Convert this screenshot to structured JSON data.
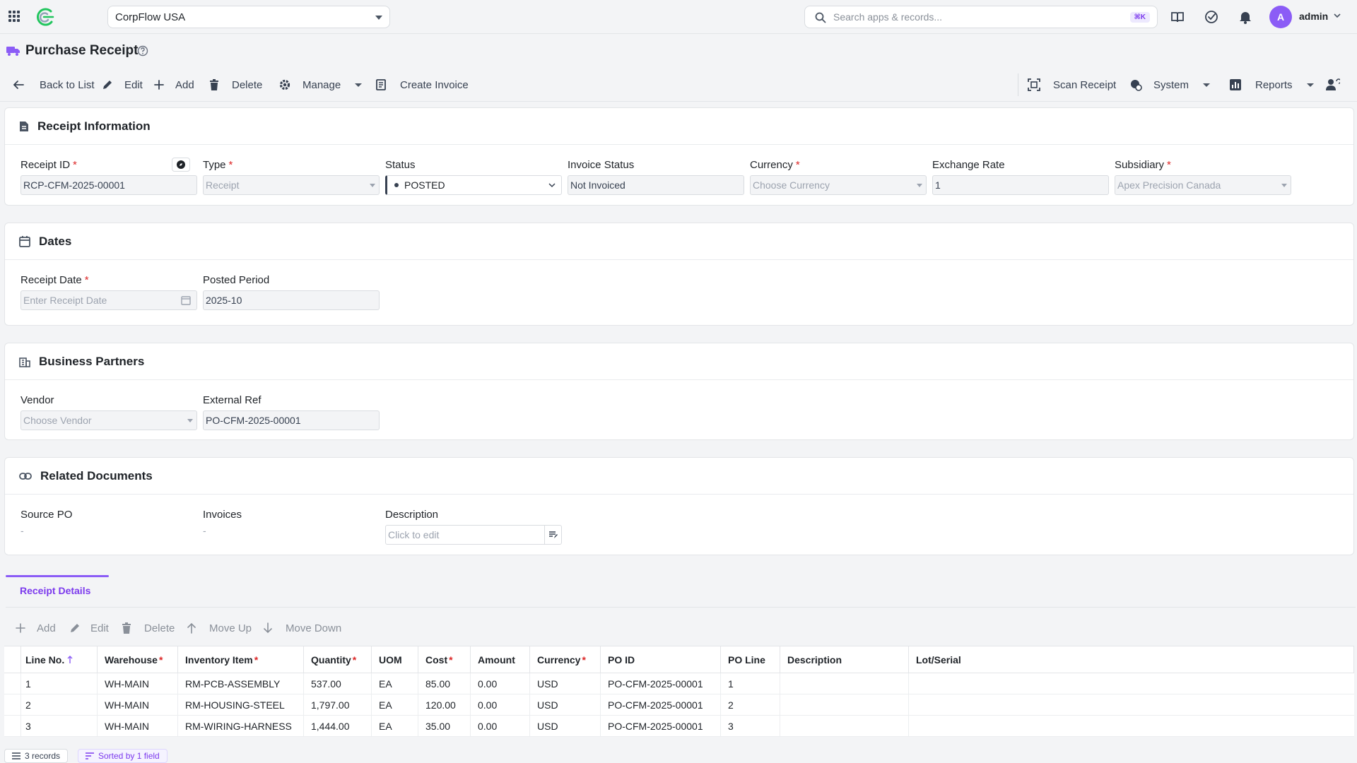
{
  "topbar": {
    "company": "CorpFlow USA",
    "search_placeholder": "Search apps & records...",
    "search_shortcut": "⌘K",
    "user_initial": "A",
    "user_name": "admin"
  },
  "page": {
    "title": "Purchase Receipt"
  },
  "toolbar": {
    "back": "Back to List",
    "edit": "Edit",
    "add": "Add",
    "delete": "Delete",
    "manage": "Manage",
    "create_invoice": "Create Invoice",
    "scan_receipt": "Scan Receipt",
    "system": "System",
    "reports": "Reports"
  },
  "receipt_info": {
    "title": "Receipt Information",
    "receipt_id_label": "Receipt ID",
    "receipt_id_value": "RCP-CFM-2025-00001",
    "type_label": "Type",
    "type_value": "Receipt",
    "status_label": "Status",
    "status_value": "POSTED",
    "invoice_status_label": "Invoice Status",
    "invoice_status_value": "Not Invoiced",
    "currency_label": "Currency",
    "currency_placeholder": "Choose Currency",
    "exchange_rate_label": "Exchange Rate",
    "exchange_rate_value": "1",
    "subsidiary_label": "Subsidiary",
    "subsidiary_value": "Apex Precision Canada"
  },
  "dates": {
    "title": "Dates",
    "receipt_date_label": "Receipt Date",
    "receipt_date_placeholder": "Enter Receipt Date",
    "posted_period_label": "Posted Period",
    "posted_period_value": "2025-10"
  },
  "partners": {
    "title": "Business Partners",
    "vendor_label": "Vendor",
    "vendor_placeholder": "Choose Vendor",
    "external_ref_label": "External Ref",
    "external_ref_value": "PO-CFM-2025-00001"
  },
  "related": {
    "title": "Related Documents",
    "source_po_label": "Source PO",
    "source_po_value": "-",
    "invoices_label": "Invoices",
    "invoices_value": "-",
    "description_label": "Description",
    "description_placeholder": "Click to edit"
  },
  "details_tab": {
    "label": "Receipt Details"
  },
  "details_toolbar": {
    "add": "Add",
    "edit": "Edit",
    "delete": "Delete",
    "move_up": "Move Up",
    "move_down": "Move Down"
  },
  "grid": {
    "columns": [
      "Line No.",
      "Warehouse",
      "Inventory Item",
      "Quantity",
      "UOM",
      "Cost",
      "Amount",
      "Currency",
      "PO ID",
      "PO Line",
      "Description",
      "Lot/Serial"
    ],
    "rows": [
      [
        "1",
        "WH-MAIN",
        "RM-PCB-ASSEMBLY",
        "537.00",
        "EA",
        "85.00",
        "0.00",
        "USD",
        "PO-CFM-2025-00001",
        "1",
        "",
        ""
      ],
      [
        "2",
        "WH-MAIN",
        "RM-HOUSING-STEEL",
        "1,797.00",
        "EA",
        "120.00",
        "0.00",
        "USD",
        "PO-CFM-2025-00001",
        "2",
        "",
        ""
      ],
      [
        "3",
        "WH-MAIN",
        "RM-WIRING-HARNESS",
        "1,444.00",
        "EA",
        "35.00",
        "0.00",
        "USD",
        "PO-CFM-2025-00001",
        "3",
        "",
        ""
      ]
    ]
  },
  "footer": {
    "records": "3 records",
    "sorted": "Sorted by 1 field"
  },
  "colors": {
    "accent": "#8b5cf6",
    "required": "#dc2626"
  }
}
